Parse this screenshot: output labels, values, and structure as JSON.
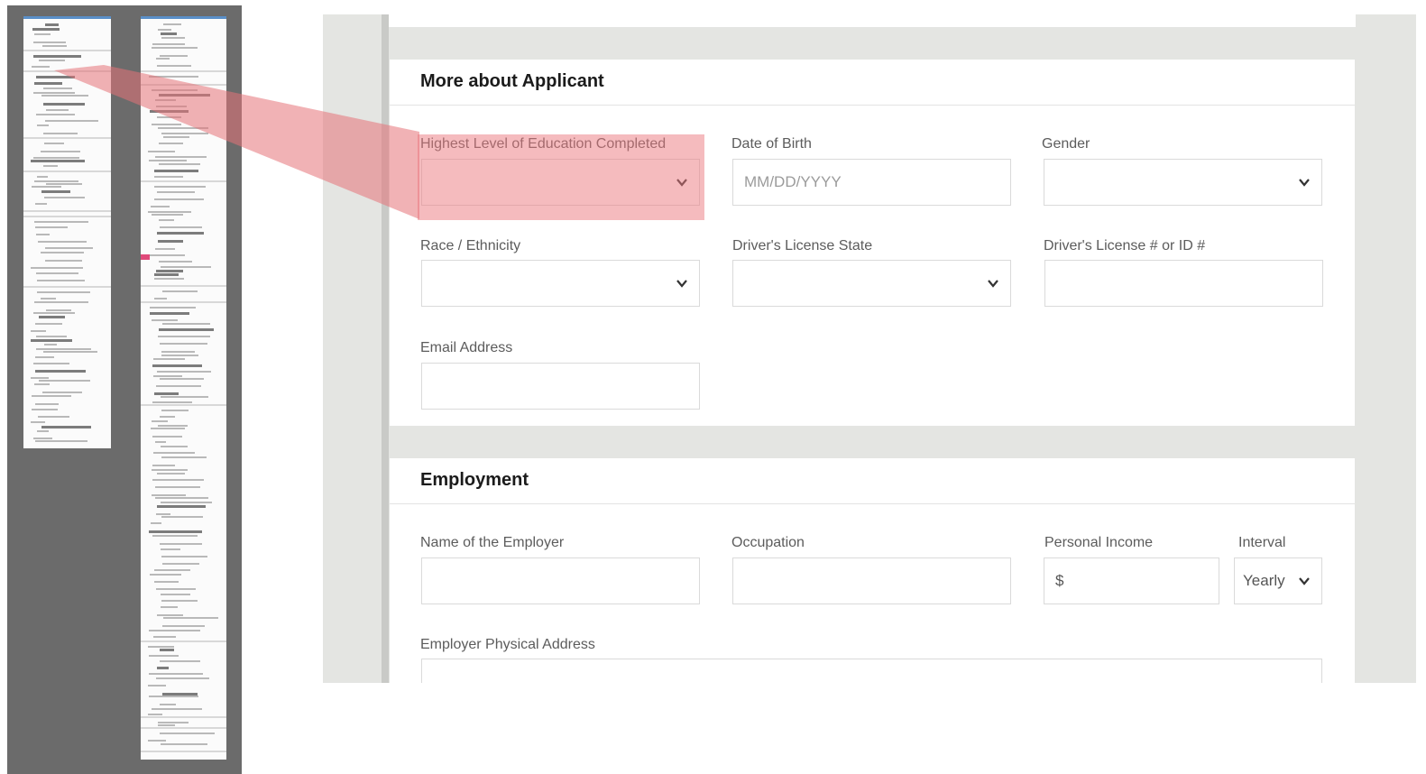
{
  "sections": {
    "applicant": {
      "title": "More about Applicant",
      "education_label": "Highest Level of Education Completed",
      "dob_label": "Date of Birth",
      "dob_placeholder": "MM/DD/YYYY",
      "gender_label": "Gender",
      "race_label": "Race / Ethnicity",
      "license_state_label": "Driver's License State",
      "license_id_label": "Driver's License # or ID #",
      "email_label": "Email Address"
    },
    "employment": {
      "title": "Employment",
      "employer_label": "Name of the Employer",
      "occupation_label": "Occupation",
      "income_label": "Personal Income",
      "income_prefix": "$",
      "interval_label": "Interval",
      "interval_value": "Yearly",
      "address_label": "Employer Physical Address"
    }
  },
  "icons": {
    "dropdown": "chevron-down-icon"
  },
  "colors": {
    "highlight": "#eb787d",
    "frame_background": "#e4e5e2",
    "thumbnail_panel": "#6b6b6b"
  }
}
